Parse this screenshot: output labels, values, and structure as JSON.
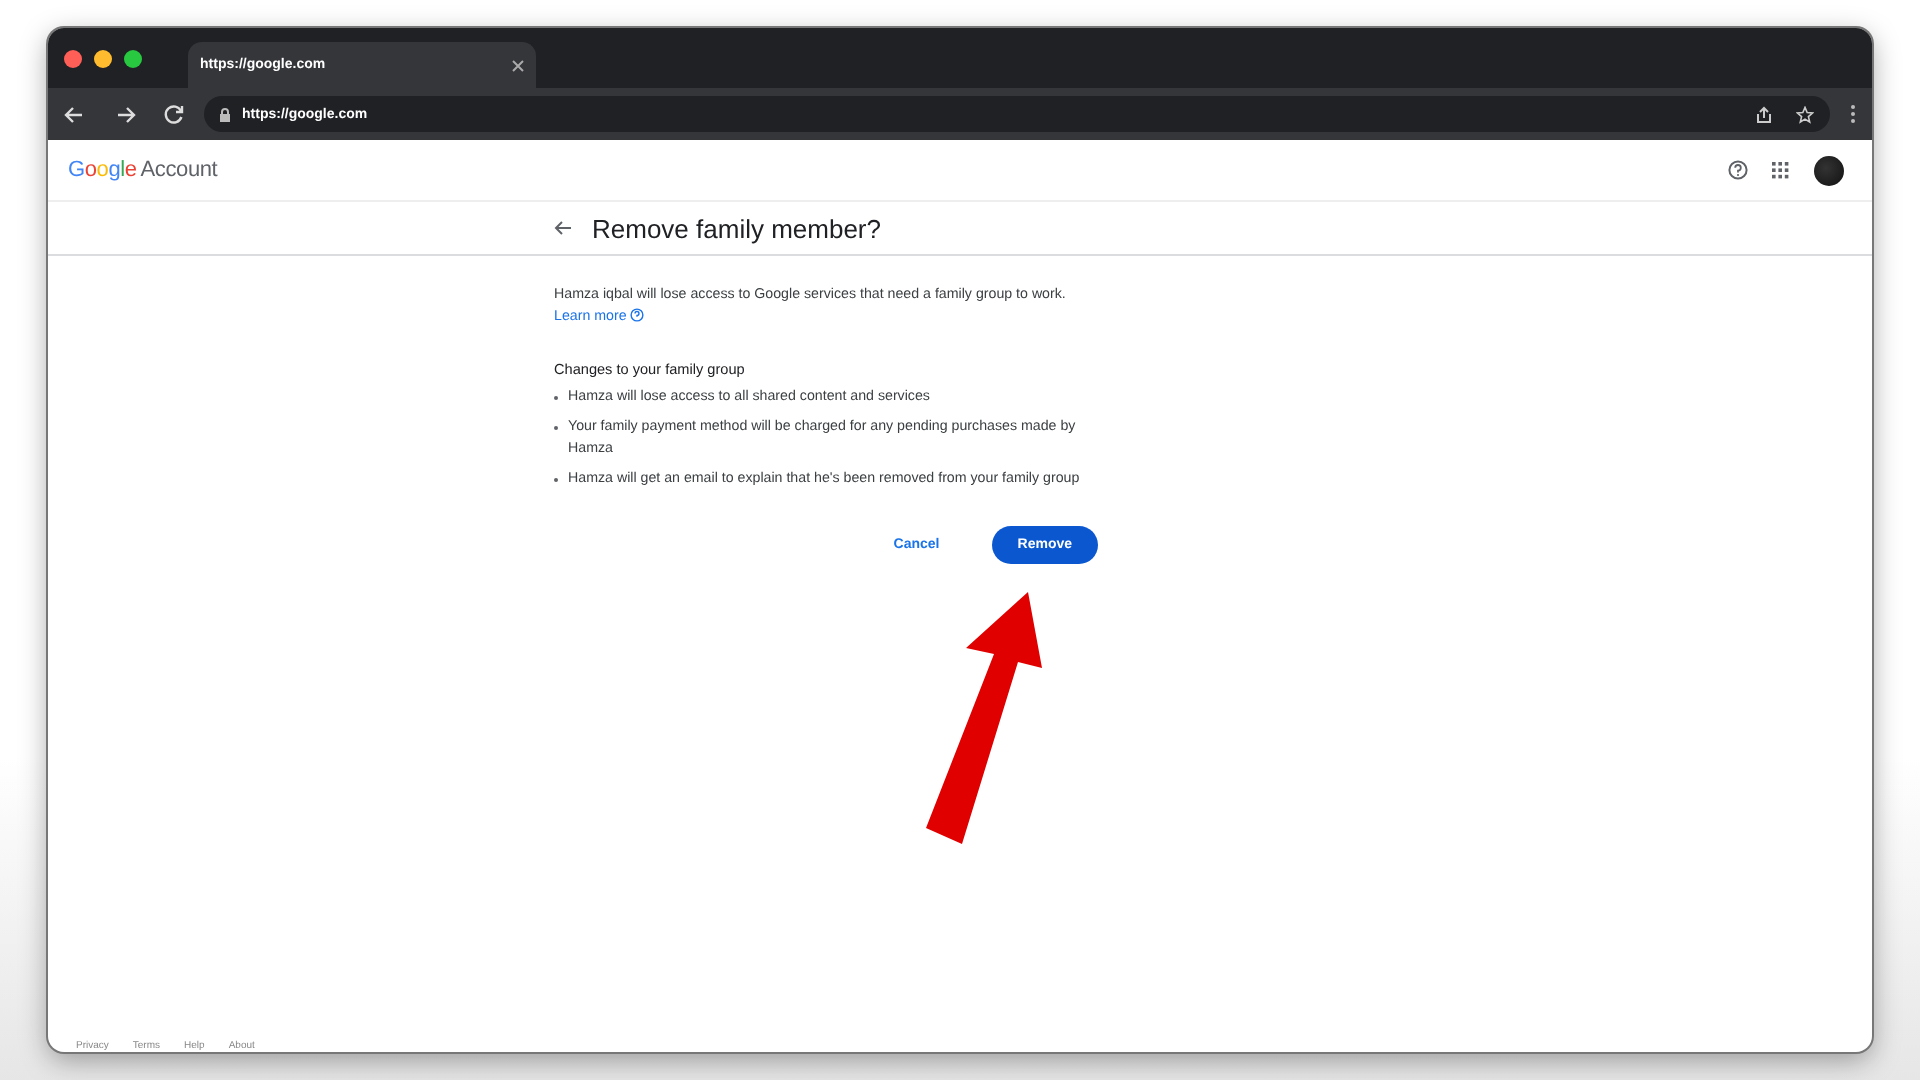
{
  "browser": {
    "tab_title": "https://google.com",
    "address": "https://google.com"
  },
  "header": {
    "logo": "Google",
    "product": "Account"
  },
  "dialog": {
    "title": "Remove family member?",
    "intro": "Hamza iqbal will lose access to Google services that need a family group to work.",
    "link": "Learn more",
    "section_title": "Changes to your family group",
    "bullets": [
      "Hamza will lose access to all shared content and services",
      "Your family payment method will be charged for any pending purchases made by Hamza",
      "Hamza will get an email to explain that he's been removed from your family group"
    ],
    "buttons": [
      {
        "label": "Cancel",
        "kind": "text"
      },
      {
        "label": "Remove",
        "kind": "filled"
      }
    ]
  },
  "footer": [
    "Privacy",
    "Terms",
    "Help",
    "About"
  ]
}
